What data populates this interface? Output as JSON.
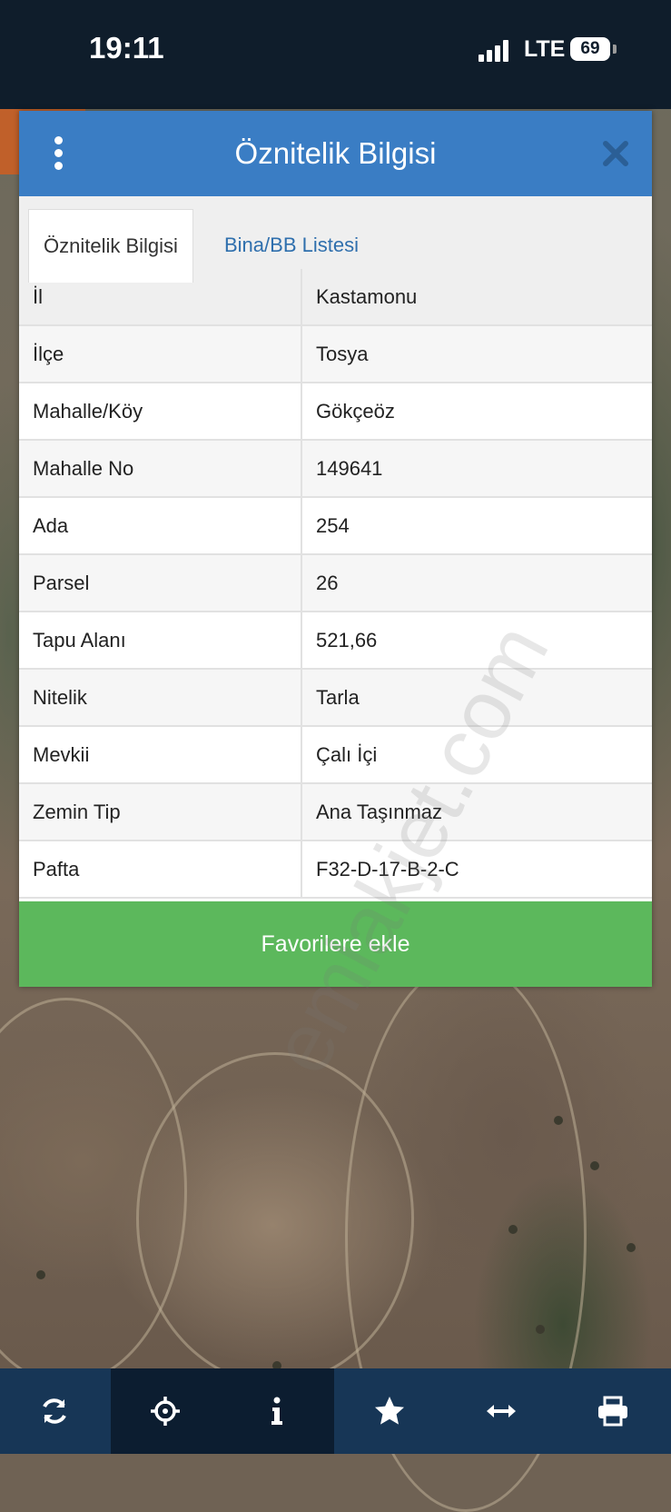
{
  "status_bar": {
    "time": "19:11",
    "network": "LTE",
    "battery": "69"
  },
  "dialog": {
    "title": "Öznitelik Bilgisi",
    "menu_icon": "more-vertical-icon",
    "close_icon": "close-icon",
    "tabs": [
      {
        "label": "Öznitelik Bilgisi",
        "active": true
      },
      {
        "label": "Bina/BB Listesi",
        "active": false
      }
    ],
    "rows": [
      {
        "key": "İl",
        "value": "Kastamonu"
      },
      {
        "key": "İlçe",
        "value": "Tosya"
      },
      {
        "key": "Mahalle/Köy",
        "value": "Gökçeöz"
      },
      {
        "key": "Mahalle No",
        "value": "149641"
      },
      {
        "key": "Ada",
        "value": "254"
      },
      {
        "key": "Parsel",
        "value": "26"
      },
      {
        "key": "Tapu Alanı",
        "value": "521,66"
      },
      {
        "key": "Nitelik",
        "value": "Tarla"
      },
      {
        "key": "Mevkii",
        "value": "Çalı İçi"
      },
      {
        "key": "Zemin Tip",
        "value": "Ana Taşınmaz"
      },
      {
        "key": "Pafta",
        "value": "F32-D-17-B-2-C"
      }
    ],
    "favorite_button": "Favorilere ekle"
  },
  "watermark": "emlakjet.com",
  "toolbar": {
    "items": [
      "refresh-icon",
      "locate-icon",
      "info-icon",
      "star-icon",
      "measure-icon",
      "print-icon"
    ],
    "selected": [
      "locate-icon",
      "info-icon"
    ]
  },
  "colors": {
    "header": "#3a7dc4",
    "favorite": "#5cb85c",
    "toolbar": "#173656",
    "accent_tab": "#c0602a"
  }
}
